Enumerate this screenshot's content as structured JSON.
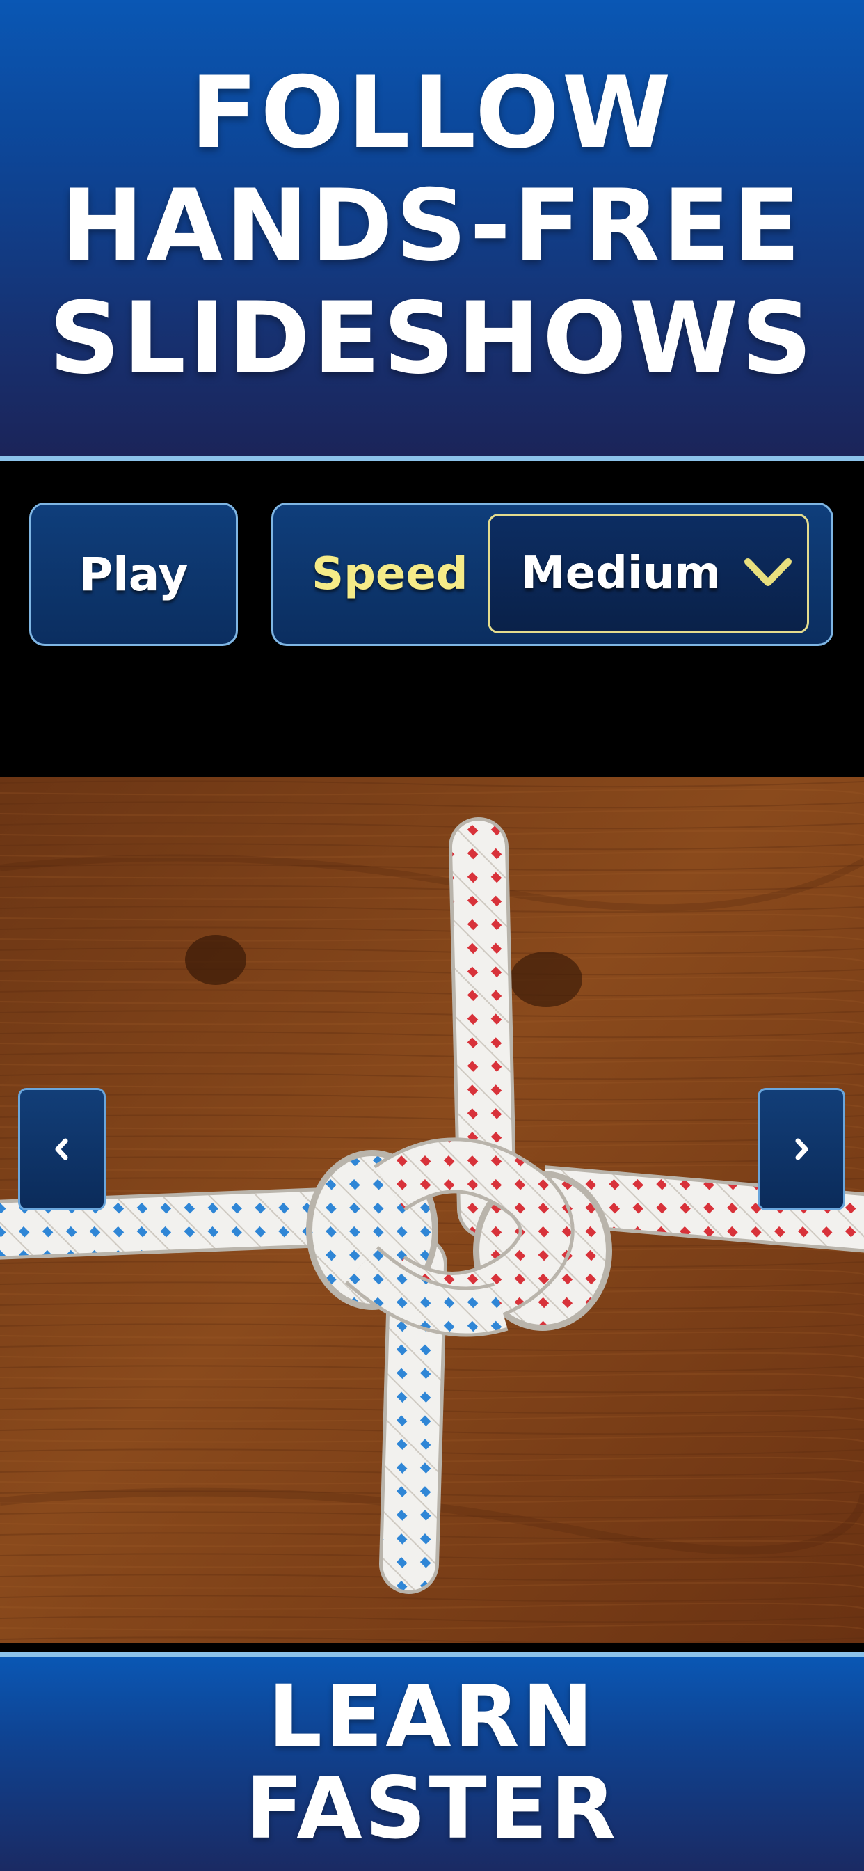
{
  "header": {
    "headline_line1": "FOLLOW",
    "headline_line2": "HANDS-FREE",
    "headline_line3": "SLIDESHOWS"
  },
  "controls": {
    "play_label": "Play",
    "speed_label": "Speed",
    "speed_value": "Medium"
  },
  "slide": {
    "image_description": "Knot tied with a blue-flecked white rope and a red-flecked white rope on a wooden surface",
    "prev_icon": "chevron-left-icon",
    "next_icon": "chevron-right-icon"
  },
  "footer": {
    "tagline_line1": "LEARN",
    "tagline_line2": "FASTER"
  },
  "colors": {
    "banner_top": "#0a57b4",
    "banner_bottom": "#1b2459",
    "accent_line": "#8cc2ea",
    "control_bg": "#0f3e7b",
    "speed_label": "#f5eb88",
    "select_border": "#e4dc8e"
  }
}
